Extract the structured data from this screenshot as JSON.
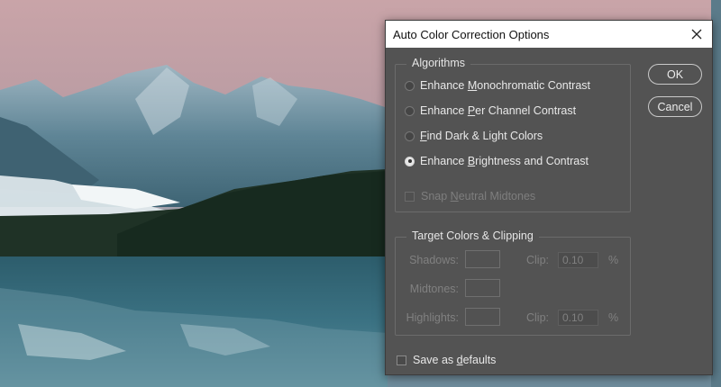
{
  "dialog": {
    "title": "Auto Color Correction Options",
    "close_icon": "close-x-icon"
  },
  "algorithms": {
    "legend": "Algorithms",
    "options": [
      {
        "pre": "Enhance ",
        "key": "M",
        "post": "onochromatic Contrast",
        "selected": false
      },
      {
        "pre": "Enhance ",
        "key": "P",
        "post": "er Channel Contrast",
        "selected": false
      },
      {
        "pre": "",
        "key": "F",
        "post": "ind Dark & Light Colors",
        "selected": false
      },
      {
        "pre": "Enhance ",
        "key": "B",
        "post": "rightness and Contrast",
        "selected": true
      }
    ],
    "snap": {
      "pre": "Snap ",
      "key": "N",
      "post": "eutral Midtones",
      "checked": false,
      "disabled": true
    }
  },
  "target": {
    "legend": "Target Colors & Clipping",
    "shadows_label": "Shadows:",
    "midtones_label": "Midtones:",
    "highlights_label": "Highlights:",
    "clip_label": "Clip:",
    "shadows_clip": "0.10",
    "highlights_clip": "0.10",
    "percent": "%"
  },
  "buttons": {
    "ok": "OK",
    "cancel": "Cancel"
  },
  "save_defaults": {
    "pre": "Save as ",
    "key": "d",
    "post": "efaults",
    "checked": false
  },
  "colors": {
    "dialog_bg": "#535353",
    "titlebar_bg": "#ffffff",
    "text": "#e8e8e8",
    "disabled_text": "#808080"
  }
}
